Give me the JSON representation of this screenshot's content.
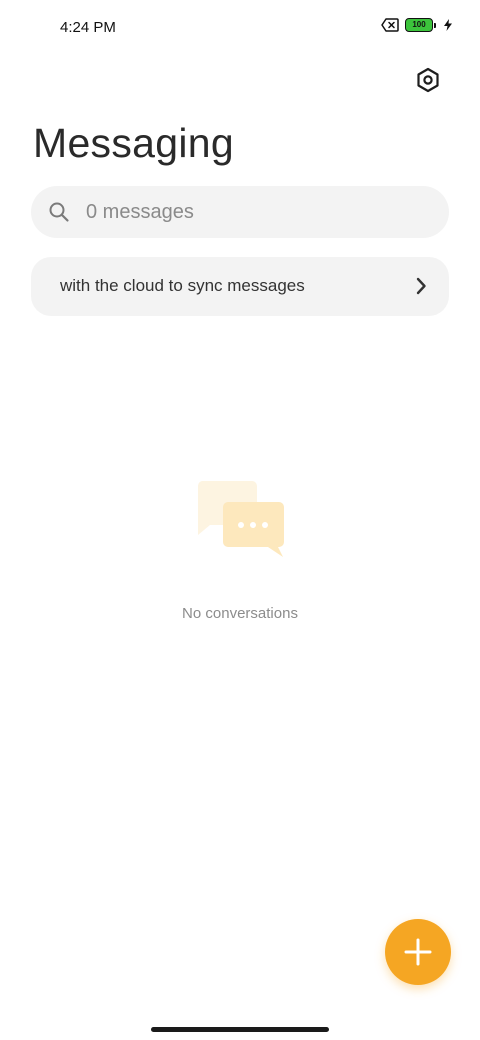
{
  "status_bar": {
    "time": "4:24 PM",
    "battery_level": "100",
    "icons": [
      "no-sim-icon",
      "battery-icon",
      "charging-icon"
    ],
    "battery_color": "#3cc43c"
  },
  "header": {
    "title": "Messaging",
    "settings_icon": "settings-icon"
  },
  "search": {
    "placeholder": "0 messages",
    "icon": "search-icon"
  },
  "sync_banner": {
    "text": "with the cloud to sync messages",
    "icon": "chevron-right-icon"
  },
  "empty_state": {
    "illustration": "chat-bubbles-icon",
    "text": "No conversations"
  },
  "fab": {
    "icon": "plus-icon",
    "color": "#f5a623"
  }
}
